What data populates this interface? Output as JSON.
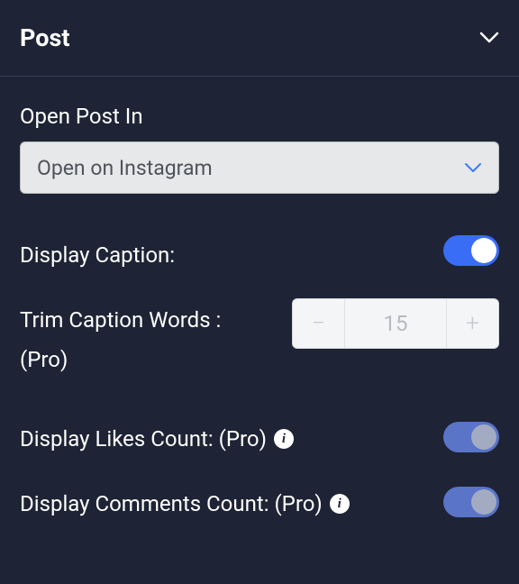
{
  "panel": {
    "title": "Post"
  },
  "fields": {
    "open_post_in": {
      "label": "Open Post In",
      "selected": "Open on Instagram"
    },
    "display_caption": {
      "label": "Display Caption:"
    },
    "trim_caption": {
      "label_line1": "Trim Caption Words :",
      "label_line2": "(Pro)",
      "value": "15"
    },
    "display_likes": {
      "label": "Display Likes Count: (Pro)"
    },
    "display_comments": {
      "label": "Display Comments Count: (Pro)"
    }
  },
  "glyphs": {
    "minus": "−",
    "plus": "+",
    "info": "i"
  }
}
